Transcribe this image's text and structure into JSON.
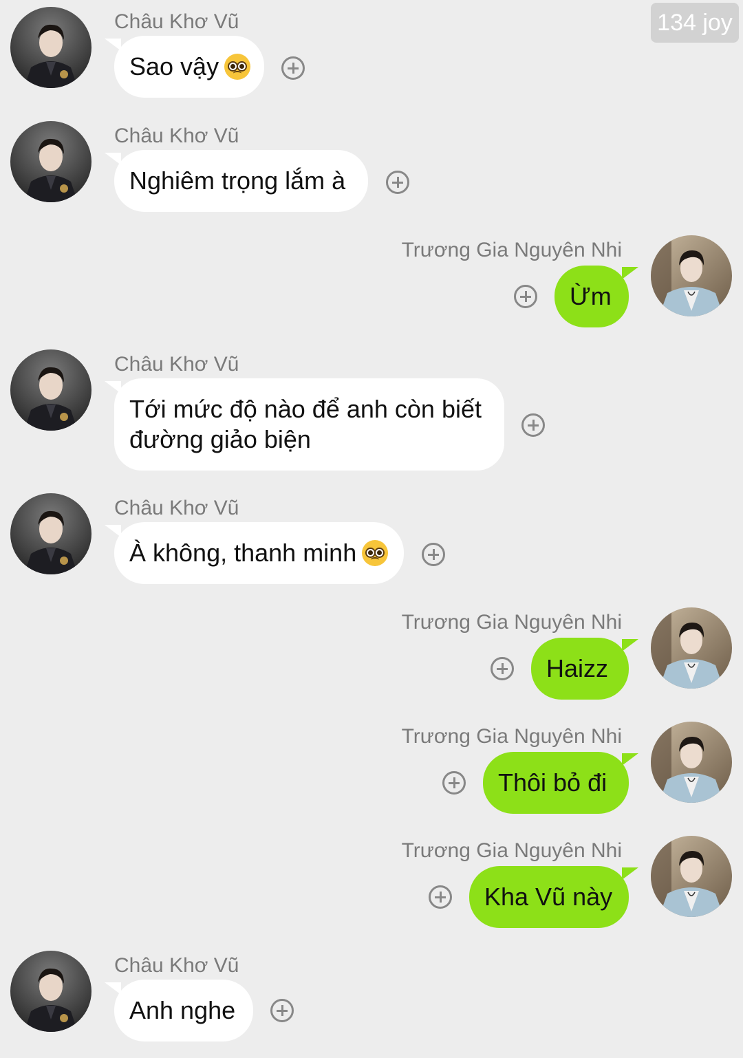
{
  "watermark": "134 joy",
  "senders": {
    "left": "Châu Khơ Vũ",
    "right": "Trương Gia Nguyên Nhi"
  },
  "messages": [
    {
      "text": "Sao vậy",
      "emoji": "pleading-face"
    },
    {
      "text": "Nghiêm trọng lắm à"
    },
    {
      "text": "Ừm"
    },
    {
      "line1": "Tới mức độ nào để anh còn biết",
      "line2": "đường giảo biện"
    },
    {
      "text": "À không, thanh minh",
      "emoji": "pleading-face"
    },
    {
      "text": "Haizz"
    },
    {
      "text": "Thôi bỏ đi"
    },
    {
      "text": "Kha Vũ này"
    },
    {
      "text": "Anh nghe"
    }
  ],
  "colors": {
    "background": "#ededed",
    "incoming_bubble": "#ffffff",
    "outgoing_bubble": "#8de018"
  }
}
